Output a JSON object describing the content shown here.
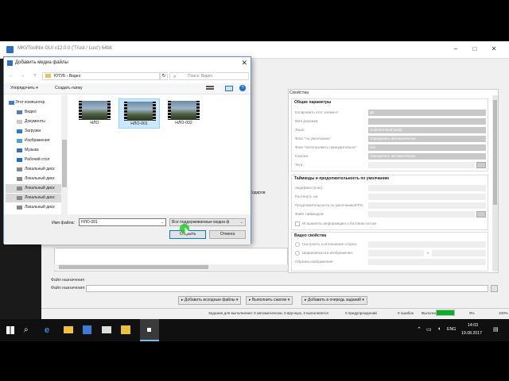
{
  "app": {
    "title": "MKVToolNix GUI v12.0.0 ('Trust / Lust') 64bit",
    "window_controls": [
      "–",
      "□",
      "✕"
    ],
    "properties_label": "Свойства",
    "general_params": {
      "title": "Общие параметры",
      "rows": [
        {
          "label": "Копировать этот элемент:",
          "value": "Да"
        },
        {
          "label": "Имя дорожки:",
          "value": ""
        },
        {
          "label": "Язык:",
          "value": "Undetermined (und)"
        },
        {
          "label": "Флаг \"по умолчанию\":",
          "value": "Определить автоматически"
        },
        {
          "label": "Флаг \"использовать принудительно\":",
          "value": "Нет"
        },
        {
          "label": "Сжатие:",
          "value": "Определить автоматически"
        },
        {
          "label": "Теги:",
          "value": ""
        }
      ]
    },
    "timecodes": {
      "title": "Таймкоды и продолжительность по умолчанию",
      "rows": [
        {
          "label": "Задержка (в мс):",
          "value": ""
        },
        {
          "label": "Растянуть на:",
          "value": ""
        },
        {
          "label": "Продолжительность по умолчанию/FPS:",
          "value": ""
        },
        {
          "label": "Файл таймкодов:",
          "value": ""
        }
      ],
      "checkbox": "Исправлять информацию о битовом потоке"
    },
    "video": {
      "title": "Видео свойства",
      "rows": [
        {
          "label": "Настроить соотношение сторон:",
          "value": ""
        },
        {
          "label": "Ширина/высота изображения:",
          "value": ""
        },
        {
          "label": "Обрезка изображения:",
          "value": ""
        }
      ],
      "x_sep": "x"
    },
    "tab_snip": "Кодиров",
    "dest_file_label": "Файл назначения",
    "dest_file_label2": "Файл назначения:",
    "actions": [
      "Добавить исходные файлы",
      "Выполнить сжатие",
      "Добавить в очередь заданий"
    ],
    "status": {
      "jobs": "Задания для выполнения: 0 автоматически, 0 вручную, 0 выполняется",
      "warnings": "0 предупреждений",
      "errors": "0 ошибок",
      "done": "Выполнено:",
      "pct_left": "0%",
      "pct_right": "100%",
      "progress": 1.0
    }
  },
  "dialog": {
    "title": "Добавить медиа файлы",
    "close": "✕",
    "nav": {
      "back": "←",
      "forward": "→",
      "up": "↑"
    },
    "breadcrumb": [
      "ЮТУБ",
      "Видео"
    ],
    "breadcrumb_sep": "›",
    "refresh": "↻",
    "search_placeholder": "Поиск: Видео",
    "toolbar": {
      "organize": "Упорядочить ▾",
      "new_folder": "Создать папку",
      "help": "?"
    },
    "nav_items": [
      {
        "label": "Этот компьютер",
        "icon": "computer-icon"
      },
      {
        "label": "Видео",
        "icon": "video-folder-icon"
      },
      {
        "label": "Документы",
        "icon": "documents-folder-icon"
      },
      {
        "label": "Загрузки",
        "icon": "downloads-folder-icon"
      },
      {
        "label": "Изображения",
        "icon": "pictures-folder-icon"
      },
      {
        "label": "Музыка",
        "icon": "music-folder-icon"
      },
      {
        "label": "Рабочий стол",
        "icon": "desktop-folder-icon"
      },
      {
        "label": "Локальный диск",
        "icon": "disk-icon"
      },
      {
        "label": "Локальный диск",
        "icon": "disk-icon"
      },
      {
        "label": "Локальный диск",
        "icon": "disk-icon"
      },
      {
        "label": "Локальный диск",
        "icon": "disk-icon"
      },
      {
        "label": "Локальный диск",
        "icon": "disk-icon"
      }
    ],
    "files": [
      {
        "name": "НЛО",
        "selected": false
      },
      {
        "name": "НЛО-001",
        "selected": true
      },
      {
        "name": "НЛО-002",
        "selected": false
      }
    ],
    "filename_label": "Имя файла:",
    "filename_value": "НЛО-001",
    "filetype": "Все поддерживаемые медиа ф",
    "open_button": "Открыть",
    "cancel_button": "Отмена"
  },
  "taskbar": {
    "lang": "ENG",
    "time": "14:03",
    "date": "19.08.2017"
  }
}
